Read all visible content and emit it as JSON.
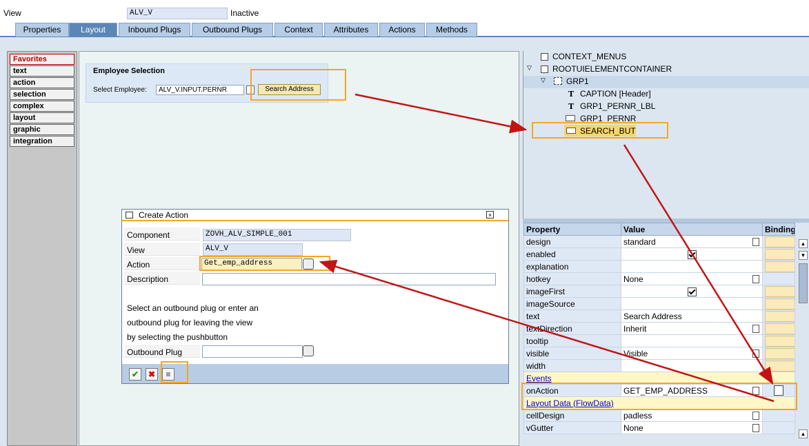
{
  "header": {
    "view_label": "View",
    "view_value": "ALV_V",
    "status": "Inactive"
  },
  "tabs": [
    "Properties",
    "Layout",
    "Inbound Plugs",
    "Outbound Plugs",
    "Context",
    "Attributes",
    "Actions",
    "Methods"
  ],
  "palette": [
    "Favorites",
    "text",
    "action",
    "selection",
    "complex",
    "layout",
    "graphic",
    "integration"
  ],
  "designer": {
    "group_title": "Employee Selection",
    "select_label": "Select Employee:",
    "input_value": "ALV_V.INPUT.PERNR",
    "button_label": "Search Address"
  },
  "tree": {
    "r1": "CONTEXT_MENUS",
    "r2": "ROOTUIELEMENTCONTAINER",
    "r3": "GRP1",
    "r4": "CAPTION  [Header]",
    "r5": "GRP1_PERNR_LBL",
    "r6": "GRP1_PERNR",
    "r7": "SEARCH_BUT"
  },
  "dialog": {
    "title": "Create Action",
    "component_label": "Component",
    "component_value": "ZOVH_ALV_SIMPLE_001",
    "view_label": "View",
    "view_value": "ALV_V",
    "action_label": "Action",
    "action_value": "Get_emp_address",
    "description_label": "Description",
    "info1": "Select an outbound plug or enter an",
    "info2": "outbound plug for leaving the view",
    "info3": "by selecting the pushbutton",
    "outbound_label": "Outbound Plug"
  },
  "props": {
    "h_property": "Property",
    "h_value": "Value",
    "h_binding": "Binding",
    "design": "design",
    "design_v": "standard",
    "enabled": "enabled",
    "explanation": "explanation",
    "hotkey": "hotkey",
    "hotkey_v": "None",
    "imageFirst": "imageFirst",
    "imageSource": "imageSource",
    "text": "text",
    "text_v": "Search Address",
    "textDirection": "textDirection",
    "textDirection_v": "Inherit",
    "tooltip": "tooltip",
    "visible": "visible",
    "visible_v": "Visible",
    "width": "width",
    "events": "Events",
    "onAction": "onAction",
    "onAction_v": "GET_EMP_ADDRESS",
    "layoutdata": "Layout Data (FlowData)",
    "cellDesign": "cellDesign",
    "cellDesign_v": "padless",
    "vGutter": "vGutter",
    "vGutter_v": "None"
  }
}
